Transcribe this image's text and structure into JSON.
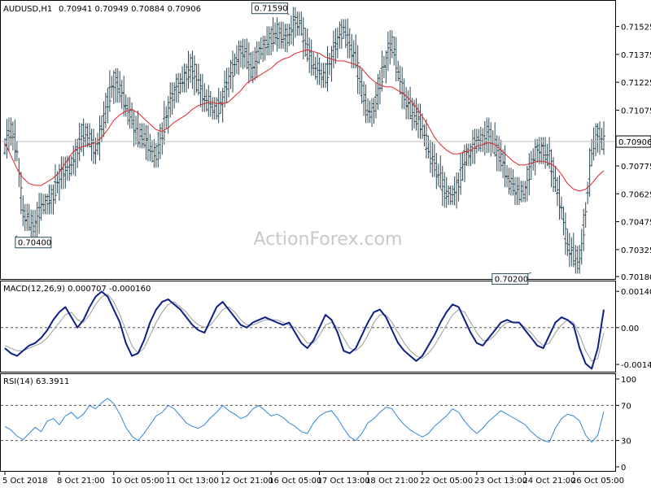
{
  "chart_data": [
    {
      "panel": "price",
      "type": "ohlc",
      "title": "AUDUSD,H1",
      "title_values": "0.70941 0.70949 0.70884 0.70906",
      "ylim": [
        0.7018,
        0.7165
      ],
      "y_ticks": [
        "0.71525",
        "0.71375",
        "0.71225",
        "0.71075",
        "0.70925",
        "0.70775",
        "0.70625",
        "0.70475",
        "0.70325",
        "0.70180"
      ],
      "last_price": "0.70906",
      "annotations": [
        {
          "label": "0.71590",
          "x": 47,
          "y": 0.7159
        },
        {
          "label": "0.70400",
          "x": 2,
          "y": 0.704
        },
        {
          "label": "0.70200",
          "x": 87,
          "y": 0.702
        }
      ],
      "watermark": "ActionForex.com",
      "series": [
        {
          "kind": "close",
          "values": [
            0.7088,
            0.7098,
            0.7085,
            0.7052,
            0.7048,
            0.7045,
            0.7056,
            0.7058,
            0.7062,
            0.7072,
            0.7075,
            0.7078,
            0.7086,
            0.7096,
            0.7092,
            0.7085,
            0.7098,
            0.7112,
            0.7124,
            0.7119,
            0.711,
            0.7102,
            0.7094,
            0.7092,
            0.7087,
            0.7082,
            0.7095,
            0.7108,
            0.7118,
            0.7122,
            0.7126,
            0.7132,
            0.7121,
            0.7114,
            0.711,
            0.7107,
            0.7114,
            0.7124,
            0.7132,
            0.714,
            0.7137,
            0.7128,
            0.714,
            0.7142,
            0.7146,
            0.715,
            0.7146,
            0.7148,
            0.7156,
            0.7152,
            0.714,
            0.7131,
            0.7128,
            0.7125,
            0.7136,
            0.7145,
            0.7152,
            0.7142,
            0.7135,
            0.7118,
            0.7106,
            0.7108,
            0.7122,
            0.7135,
            0.7145,
            0.7128,
            0.7115,
            0.7108,
            0.7104,
            0.7098,
            0.7086,
            0.7078,
            0.707,
            0.7062,
            0.7062,
            0.7068,
            0.7082,
            0.7085,
            0.7092,
            0.709,
            0.7096,
            0.7088,
            0.7082,
            0.7072,
            0.7066,
            0.7063,
            0.7063,
            0.7078,
            0.7087,
            0.7086,
            0.7082,
            0.7068,
            0.7055,
            0.7034,
            0.703,
            0.7025,
            0.7052,
            0.7085,
            0.7096,
            0.709
          ]
        },
        {
          "kind": "ma",
          "values": [
            0.709,
            0.7083,
            0.7076,
            0.7071,
            0.7068,
            0.7067,
            0.7067,
            0.7069,
            0.7071,
            0.7074,
            0.7079,
            0.7084,
            0.7087,
            0.7088,
            0.7089,
            0.709,
            0.7093,
            0.7097,
            0.7102,
            0.7105,
            0.7107,
            0.7108,
            0.7106,
            0.7103,
            0.71,
            0.7097,
            0.7096,
            0.7098,
            0.7101,
            0.7103,
            0.7105,
            0.7108,
            0.711,
            0.7111,
            0.7112,
            0.7111,
            0.7111,
            0.7112,
            0.7115,
            0.7118,
            0.7122,
            0.7124,
            0.7126,
            0.7128,
            0.713,
            0.7133,
            0.7135,
            0.7136,
            0.7138,
            0.7139,
            0.714,
            0.7139,
            0.7138,
            0.7136,
            0.7135,
            0.7134,
            0.7134,
            0.7133,
            0.7132,
            0.713,
            0.7126,
            0.7123,
            0.7121,
            0.712,
            0.712,
            0.7118,
            0.7116,
            0.7113,
            0.7109,
            0.7104,
            0.7099,
            0.7093,
            0.7089,
            0.7086,
            0.7084,
            0.7084,
            0.7085,
            0.7086,
            0.7088,
            0.7089,
            0.709,
            0.7089,
            0.7086,
            0.7083,
            0.708,
            0.7078,
            0.7078,
            0.7079,
            0.708,
            0.708,
            0.7079,
            0.7077,
            0.7073,
            0.7068,
            0.7065,
            0.7064,
            0.7065,
            0.7068,
            0.7072,
            0.7075
          ]
        }
      ]
    },
    {
      "panel": "macd",
      "type": "line",
      "title": "MACD(12,26,9) 0.000707 -0.000160",
      "ylim": [
        -0.00165,
        0.0017
      ],
      "y_ticks": [
        "0.001408",
        "0.00",
        "-0.001432"
      ],
      "series": [
        {
          "kind": "macd",
          "values": [
            -0.0008,
            -0.001,
            -0.0011,
            -0.0009,
            -0.0007,
            -0.0006,
            -0.0004,
            -0.0001,
            0.0003,
            0.0006,
            0.0008,
            0.0004,
            0.0,
            0.0003,
            0.0008,
            0.0012,
            0.0014,
            0.0012,
            0.0007,
            0.0002,
            -0.0006,
            -0.0011,
            -0.001,
            -0.0005,
            0.0002,
            0.0007,
            0.001,
            0.0011,
            0.0009,
            0.0007,
            0.0004,
            0.0001,
            -0.0001,
            -0.0002,
            0.0003,
            0.0008,
            0.001,
            0.0007,
            0.0004,
            0.0001,
            0.0,
            0.0002,
            0.0003,
            0.0004,
            0.0003,
            0.0002,
            0.0001,
            0.0002,
            -0.0002,
            -0.0006,
            -0.0008,
            -0.0005,
            0.0,
            0.0005,
            0.0003,
            -0.0002,
            -0.0009,
            -0.001,
            -0.0008,
            -0.0003,
            0.0002,
            0.0006,
            0.0007,
            0.0004,
            -0.0001,
            -0.0006,
            -0.0009,
            -0.0011,
            -0.0013,
            -0.0011,
            -0.0007,
            -0.0003,
            0.0002,
            0.0006,
            0.0009,
            0.0008,
            0.0003,
            -0.0002,
            -0.0006,
            -0.0007,
            -0.0004,
            -0.0001,
            0.0002,
            0.0003,
            0.0002,
            0.0002,
            -0.0001,
            -0.0004,
            -0.0007,
            -0.0008,
            -0.0003,
            0.0002,
            0.0004,
            0.0003,
            0.0001,
            -0.0008,
            -0.0014,
            -0.0016,
            -0.0008,
            0.0007
          ]
        },
        {
          "kind": "signal",
          "values": [
            -0.0007,
            -0.0008,
            -0.0009,
            -0.0009,
            -0.0008,
            -0.0007,
            -0.0006,
            -0.0004,
            -0.0001,
            0.0002,
            0.0005,
            0.0006,
            0.0003,
            0.0002,
            0.0005,
            0.0009,
            0.0012,
            0.0013,
            0.001,
            0.0005,
            -0.0001,
            -0.0007,
            -0.001,
            -0.0008,
            -0.0003,
            0.0002,
            0.0006,
            0.0009,
            0.001,
            0.0008,
            0.0006,
            0.0003,
            0.0001,
            0.0,
            0.0001,
            0.0004,
            0.0007,
            0.0008,
            0.0006,
            0.0003,
            0.0001,
            0.0001,
            0.0002,
            0.0003,
            0.0003,
            0.0003,
            0.0002,
            0.0001,
            0.0,
            -0.0003,
            -0.0006,
            -0.0006,
            -0.0003,
            0.0001,
            0.0002,
            0.0,
            -0.0004,
            -0.0008,
            -0.0009,
            -0.0007,
            -0.0003,
            0.0002,
            0.0005,
            0.0005,
            0.0002,
            -0.0002,
            -0.0006,
            -0.0009,
            -0.0011,
            -0.0012,
            -0.001,
            -0.0007,
            -0.0003,
            0.0001,
            0.0005,
            0.0007,
            0.0006,
            0.0002,
            -0.0002,
            -0.0005,
            -0.0005,
            -0.0003,
            0.0,
            0.0002,
            0.0002,
            0.0002,
            0.0,
            -0.0002,
            -0.0005,
            -0.0007,
            -0.0006,
            -0.0002,
            0.0001,
            0.0003,
            0.0002,
            -0.0003,
            -0.0009,
            -0.0013,
            -0.0012,
            -0.0002
          ]
        }
      ]
    },
    {
      "panel": "rsi",
      "type": "line",
      "title": "RSI(14) 63.3911",
      "ylim": [
        0,
        100
      ],
      "y_ticks": [
        "100",
        "70",
        "30",
        "0"
      ],
      "levels": [
        70,
        30
      ],
      "series": [
        {
          "kind": "rsi",
          "values": [
            46,
            42,
            35,
            31,
            38,
            45,
            40,
            52,
            55,
            48,
            58,
            62,
            55,
            60,
            70,
            66,
            73,
            78,
            72,
            60,
            45,
            35,
            30,
            38,
            48,
            58,
            62,
            70,
            66,
            58,
            50,
            46,
            44,
            48,
            56,
            62,
            70,
            64,
            60,
            55,
            58,
            66,
            70,
            64,
            58,
            60,
            56,
            50,
            46,
            40,
            38,
            50,
            58,
            62,
            64,
            55,
            44,
            34,
            30,
            38,
            50,
            55,
            62,
            68,
            66,
            56,
            48,
            42,
            38,
            34,
            38,
            46,
            52,
            58,
            66,
            62,
            52,
            44,
            38,
            44,
            52,
            58,
            64,
            60,
            56,
            52,
            48,
            40,
            34,
            30,
            28,
            44,
            55,
            60,
            58,
            52,
            36,
            28,
            36,
            63
          ]
        }
      ]
    }
  ],
  "x_axis": {
    "tick_labels": [
      "5 Oct 2018",
      "8 Oct 21:00",
      "10 Oct 05:00",
      "11 Oct 13:00",
      "12 Oct 21:00",
      "16 Oct 05:00",
      "17 Oct 13:00",
      "18 Oct 21:00",
      "22 Oct 05:00",
      "23 Oct 13:00",
      "24 Oct 21:00",
      "26 Oct 05:00"
    ],
    "tick_index": [
      0,
      9,
      18,
      27,
      36,
      44,
      52,
      60,
      69,
      78,
      86,
      94
    ]
  },
  "colors": {
    "bars": "#2c4a56",
    "ma": "#e0242b",
    "macd": "#0e1f8a",
    "signal": "#9a9a9a",
    "rsi": "#2f86d8",
    "grid_dash": "#555555"
  }
}
